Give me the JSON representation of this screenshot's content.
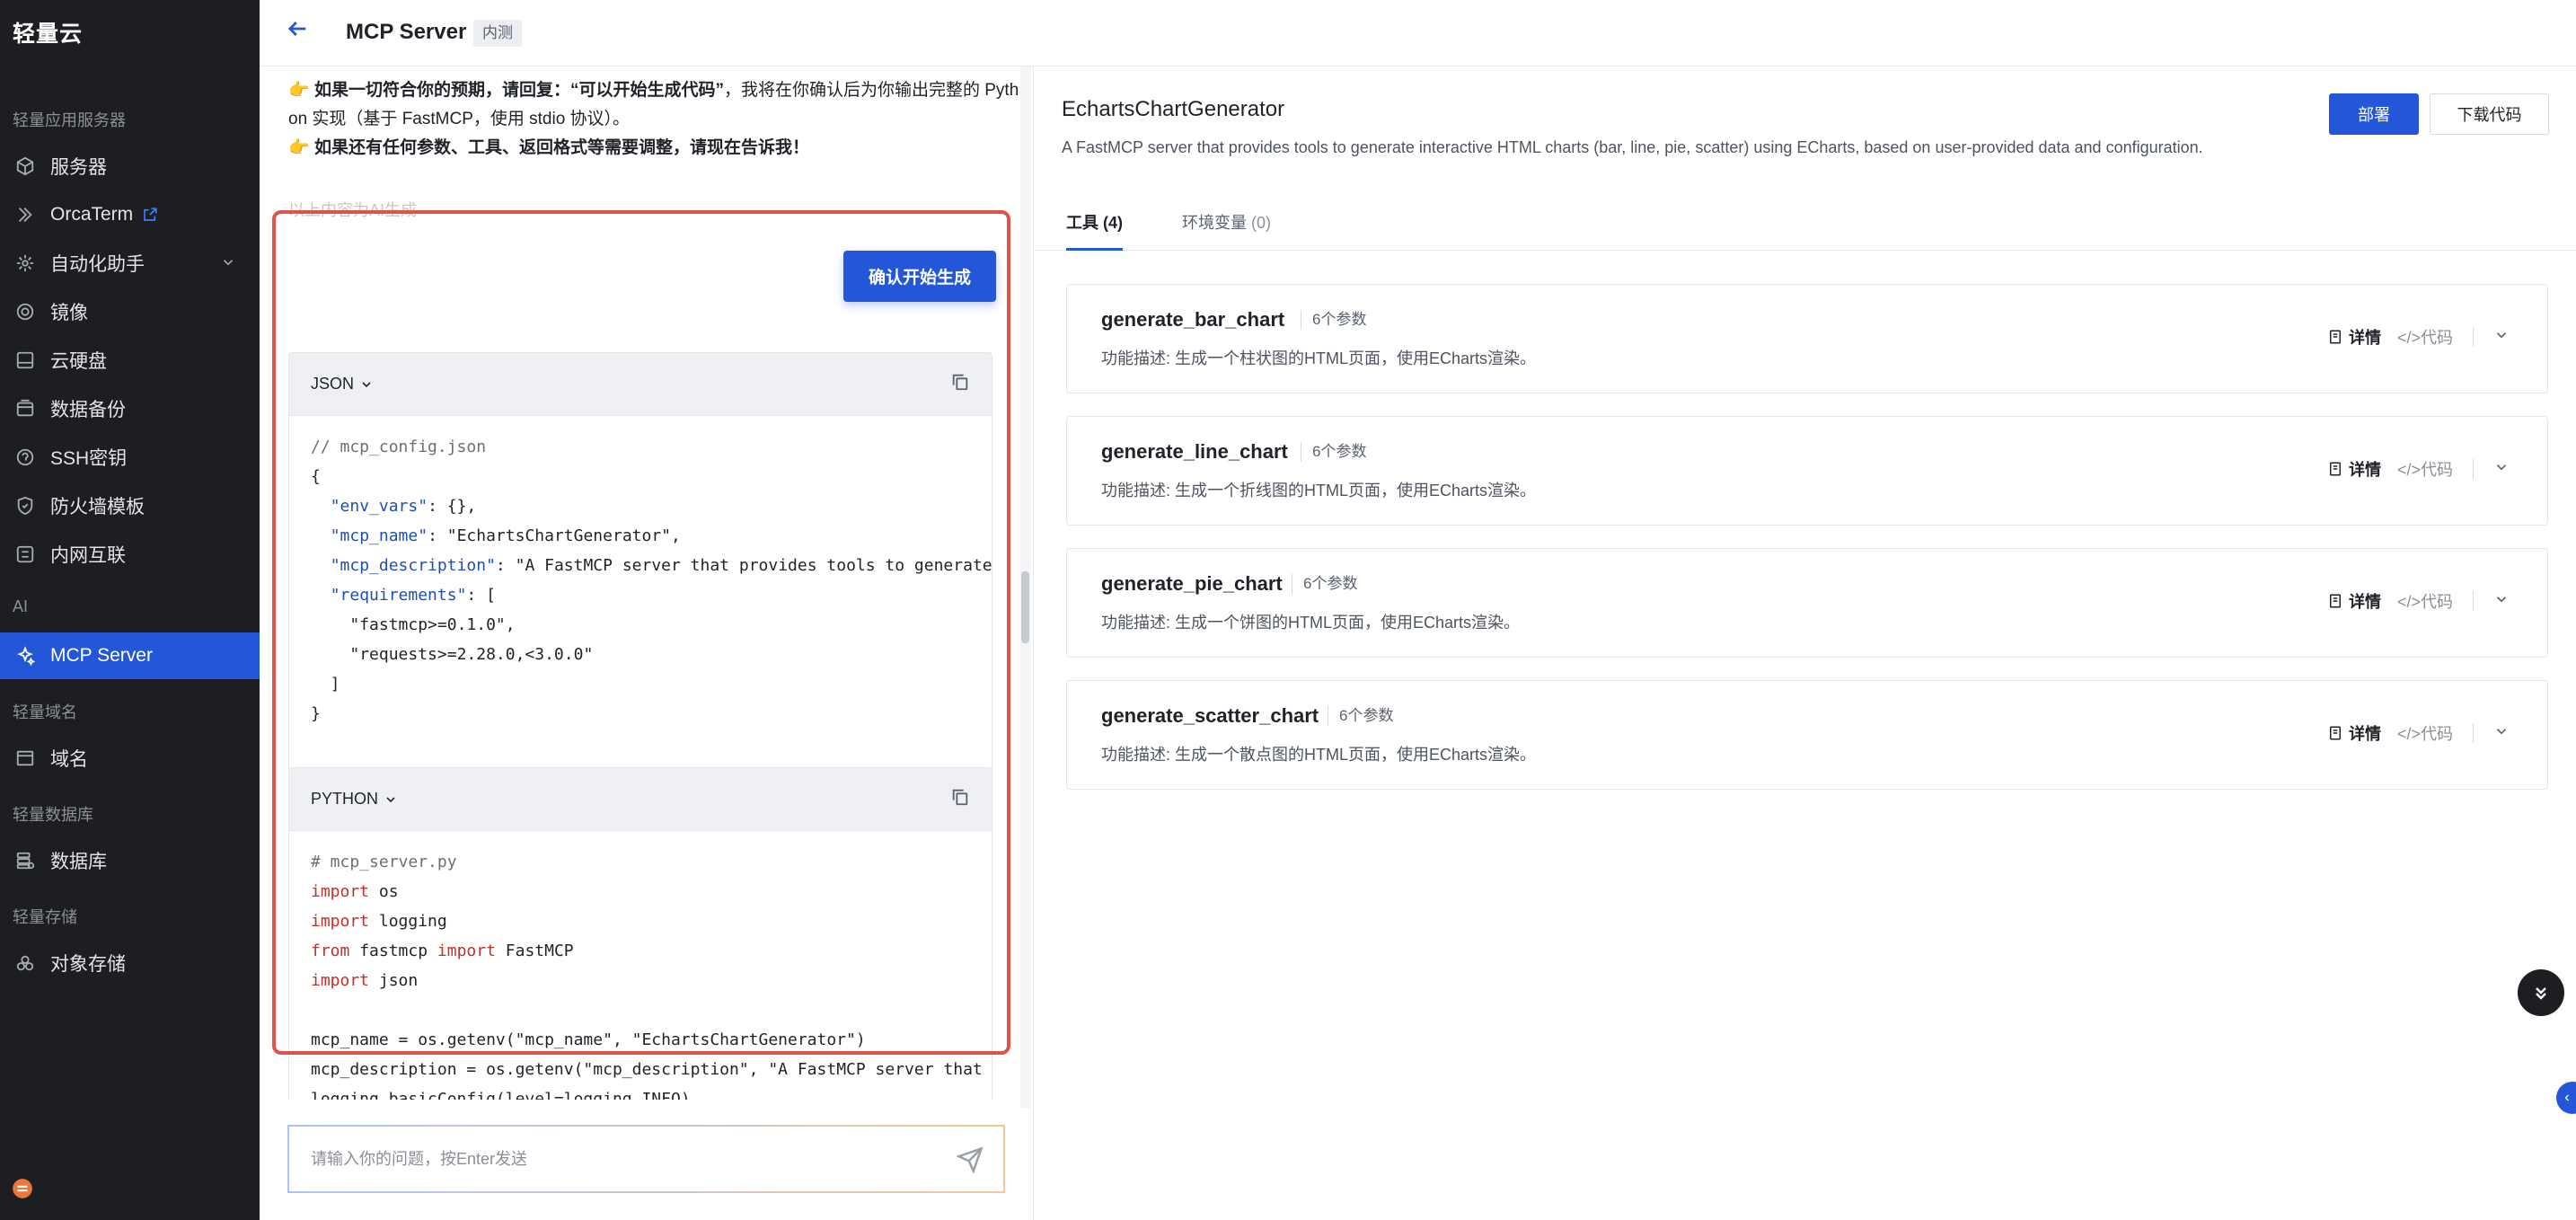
{
  "app": {
    "brand": "轻量云"
  },
  "sidebar": {
    "groups": {
      "light_server": "轻量应用服务器",
      "ai": "AI",
      "domain": "轻量域名",
      "database": "轻量数据库",
      "storage": "轻量存储"
    },
    "items": [
      {
        "label": "服务器",
        "icon": "server-icon"
      },
      {
        "label": "OrcaTerm",
        "icon": "terminal-icon"
      },
      {
        "label": "自动化助手",
        "icon": "automation-icon"
      },
      {
        "label": "镜像",
        "icon": "image-icon"
      },
      {
        "label": "云硬盘",
        "icon": "disk-icon"
      },
      {
        "label": "数据备份",
        "icon": "backup-icon"
      },
      {
        "label": "SSH密钥",
        "icon": "key-icon"
      },
      {
        "label": "防火墙模板",
        "icon": "firewall-icon"
      },
      {
        "label": "内网互联",
        "icon": "network-icon"
      },
      {
        "label": "MCP Server",
        "icon": "sparkle-icon",
        "active": true
      },
      {
        "label": "域名",
        "icon": "domain-icon"
      },
      {
        "label": "数据库",
        "icon": "database-icon"
      },
      {
        "label": "对象存储",
        "icon": "object-storage-icon"
      }
    ]
  },
  "header": {
    "title": "MCP Server",
    "badge": "内测"
  },
  "chat": {
    "lines": [
      {
        "bold": "如果一切符合你的预期，请回复：“可以开始生成代码”",
        "text": "，我将在你确认后为你输出完整的 Pyth"
      },
      {
        "bold": "",
        "text": "on 实现（基于 FastMCP，使用 stdio 协议）。"
      },
      {
        "bold": "如果还有任何参数、工具、返回格式等需要调整，请现在告诉我！",
        "text": ""
      }
    ],
    "ai_note": "以上内容为AI生成",
    "confirm_button": "确认开始生成",
    "json_block": {
      "lang": "JSON",
      "lines": [
        [
          {
            "t": "cm",
            "v": "// mcp_config.json"
          }
        ],
        [
          {
            "t": "p",
            "v": "{"
          }
        ],
        [
          {
            "t": "p",
            "v": "  "
          },
          {
            "t": "key",
            "v": "\"env_vars\""
          },
          {
            "t": "p",
            "v": ": {},"
          }
        ],
        [
          {
            "t": "p",
            "v": "  "
          },
          {
            "t": "key",
            "v": "\"mcp_name\""
          },
          {
            "t": "p",
            "v": ": "
          },
          {
            "t": "str",
            "v": "\"EchartsChartGenerator\""
          },
          {
            "t": "p",
            "v": ","
          }
        ],
        [
          {
            "t": "p",
            "v": "  "
          },
          {
            "t": "key",
            "v": "\"mcp_description\""
          },
          {
            "t": "p",
            "v": ": "
          },
          {
            "t": "str",
            "v": "\"A FastMCP server that provides tools to generate"
          }
        ],
        [
          {
            "t": "p",
            "v": "  "
          },
          {
            "t": "key",
            "v": "\"requirements\""
          },
          {
            "t": "p",
            "v": ": ["
          }
        ],
        [
          {
            "t": "p",
            "v": "    "
          },
          {
            "t": "str",
            "v": "\"fastmcp>=0.1.0\""
          },
          {
            "t": "p",
            "v": ","
          }
        ],
        [
          {
            "t": "p",
            "v": "    "
          },
          {
            "t": "str",
            "v": "\"requests>=2.28.0,<3.0.0\""
          }
        ],
        [
          {
            "t": "p",
            "v": "  ]"
          }
        ],
        [
          {
            "t": "p",
            "v": "}"
          }
        ]
      ]
    },
    "python_block": {
      "lang": "PYTHON",
      "lines": [
        [
          {
            "t": "cm",
            "v": "# mcp_server.py"
          }
        ],
        [
          {
            "t": "kw",
            "v": "import"
          },
          {
            "t": "p",
            "v": " os"
          }
        ],
        [
          {
            "t": "kw",
            "v": "import"
          },
          {
            "t": "p",
            "v": " logging"
          }
        ],
        [
          {
            "t": "kw",
            "v": "from"
          },
          {
            "t": "p",
            "v": " fastmcp "
          },
          {
            "t": "kw",
            "v": "import"
          },
          {
            "t": "p",
            "v": " FastMCP"
          }
        ],
        [
          {
            "t": "kw",
            "v": "import"
          },
          {
            "t": "p",
            "v": " json"
          }
        ],
        [
          {
            "t": "p",
            "v": " "
          }
        ],
        [
          {
            "t": "p",
            "v": "mcp_name = os.getenv(\"mcp_name\", \"EchartsChartGenerator\")"
          }
        ],
        [
          {
            "t": "p",
            "v": "mcp_description = os.getenv(\"mcp_description\", \"A FastMCP server that"
          }
        ],
        [
          {
            "t": "p",
            "v": "logging.basicConfig(level=logging.INFO)"
          }
        ]
      ]
    },
    "input_placeholder": "请输入你的问题，按Enter发送"
  },
  "detail": {
    "name": "EchartsChartGenerator",
    "description": "A FastMCP server that provides tools to generate interactive HTML charts (bar, line, pie, scatter) using ECharts, based on user-provided data and configuration.",
    "deploy_label": "部署",
    "download_label": "下载代码",
    "tabs": [
      {
        "label": "工具",
        "count": "(4)"
      },
      {
        "label": "环境变量",
        "count": "(0)"
      }
    ],
    "tools": [
      {
        "name": "generate_bar_chart",
        "params": "6个参数",
        "desc": "功能描述: 生成一个柱状图的HTML页面，使用ECharts渲染。"
      },
      {
        "name": "generate_line_chart",
        "params": "6个参数",
        "desc": "功能描述: 生成一个折线图的HTML页面，使用ECharts渲染。"
      },
      {
        "name": "generate_pie_chart",
        "params": "6个参数",
        "desc": "功能描述: 生成一个饼图的HTML页面，使用ECharts渲染。"
      },
      {
        "name": "generate_scatter_chart",
        "params": "6个参数",
        "desc": "功能描述: 生成一个散点图的HTML页面，使用ECharts渲染。"
      }
    ],
    "action_detail": "详情",
    "action_code": "</>代码"
  }
}
